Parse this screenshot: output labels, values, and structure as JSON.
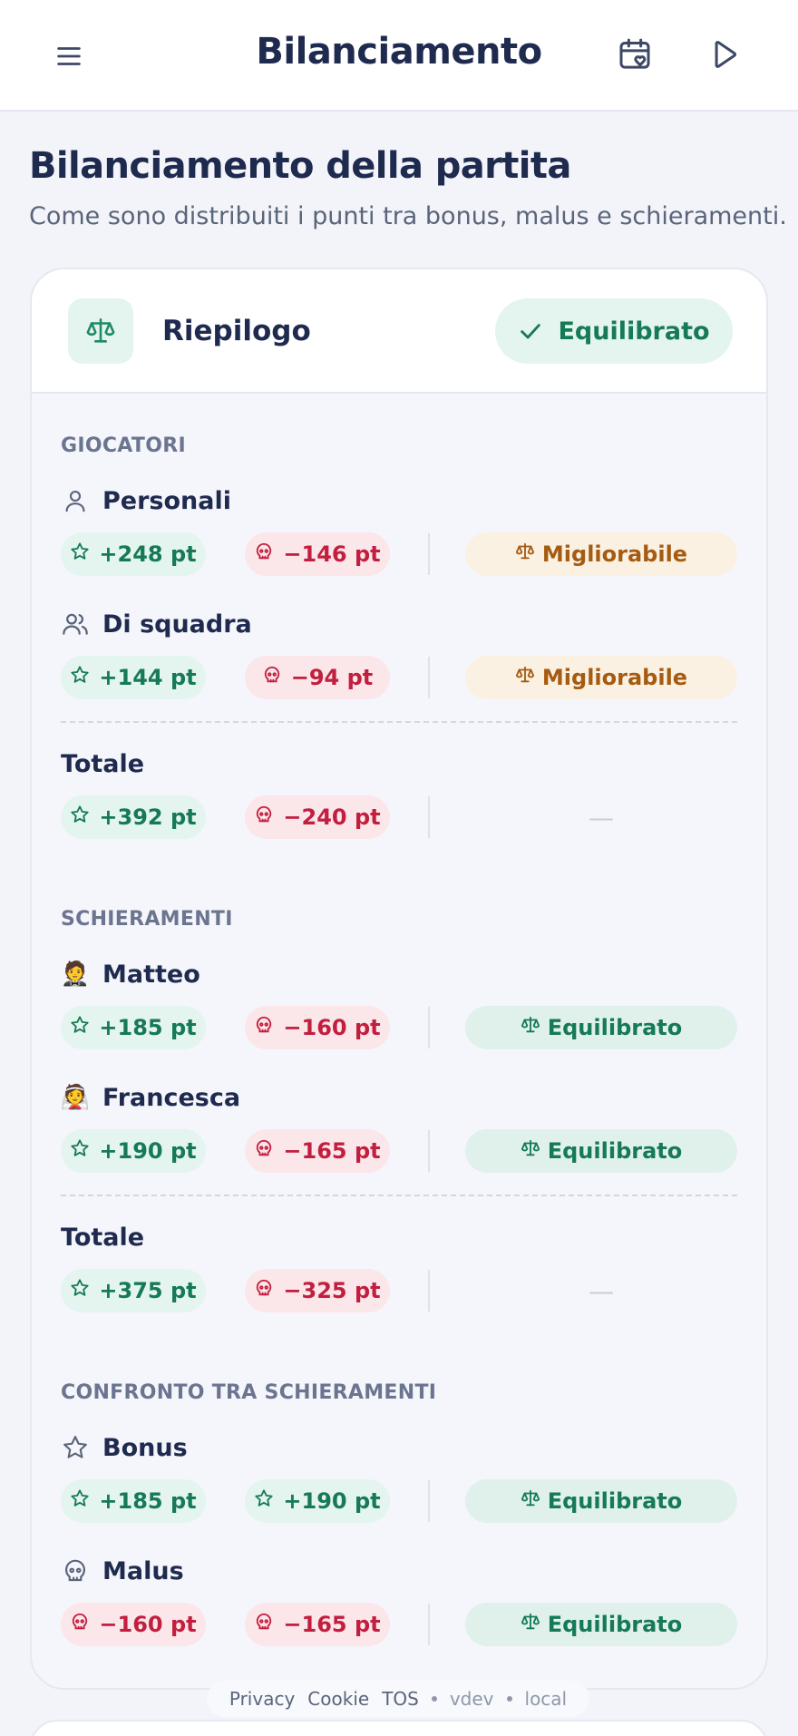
{
  "header": {
    "title": "Bilanciamento"
  },
  "page": {
    "title": "Bilanciamento della partita",
    "subtitle": "Come sono distribuiti i punti tra bonus, malus e schieramenti."
  },
  "summary": {
    "title": "Riepilogo",
    "status": "Equilibrato"
  },
  "players": {
    "label": "GIOCATORI",
    "personal": {
      "label": "Personali",
      "bonus": "+248 pt",
      "malus": "−146 pt",
      "state": "Migliorabile"
    },
    "team": {
      "label": "Di squadra",
      "bonus": "+144 pt",
      "malus": "−94 pt",
      "state": "Migliorabile"
    },
    "total": {
      "label": "Totale",
      "bonus": "+392 pt",
      "malus": "−240 pt",
      "state": "—"
    }
  },
  "sides": {
    "label": "SCHIERAMENTI",
    "matteo": {
      "emoji": "🤵",
      "label": "Matteo",
      "bonus": "+185 pt",
      "malus": "−160 pt",
      "state": "Equilibrato"
    },
    "francesca": {
      "emoji": "👰",
      "label": "Francesca",
      "bonus": "+190 pt",
      "malus": "−165 pt",
      "state": "Equilibrato"
    },
    "total": {
      "label": "Totale",
      "bonus": "+375 pt",
      "malus": "−325 pt",
      "state": "—"
    }
  },
  "comparison": {
    "label": "CONFRONTO TRA SCHIERAMENTI",
    "bonus": {
      "label": "Bonus",
      "left": "+185 pt",
      "right": "+190 pt",
      "state": "Equilibrato"
    },
    "malus": {
      "label": "Malus",
      "left": "−160 pt",
      "right": "−165 pt",
      "state": "Equilibrato"
    }
  },
  "footer": {
    "links": [
      "Privacy",
      "Cookie",
      "TOS"
    ],
    "version": "vdev",
    "env": "local"
  },
  "colors": {
    "bonus": "#157a55",
    "malus": "#c21f3f",
    "warning": "#a55b12",
    "title": "#1f2a4f"
  },
  "icons": [
    "menu-icon",
    "calendar-heart-icon",
    "play-icon",
    "scale-icon",
    "check-icon",
    "user-icon",
    "users-icon",
    "star-icon",
    "skull-icon"
  ]
}
